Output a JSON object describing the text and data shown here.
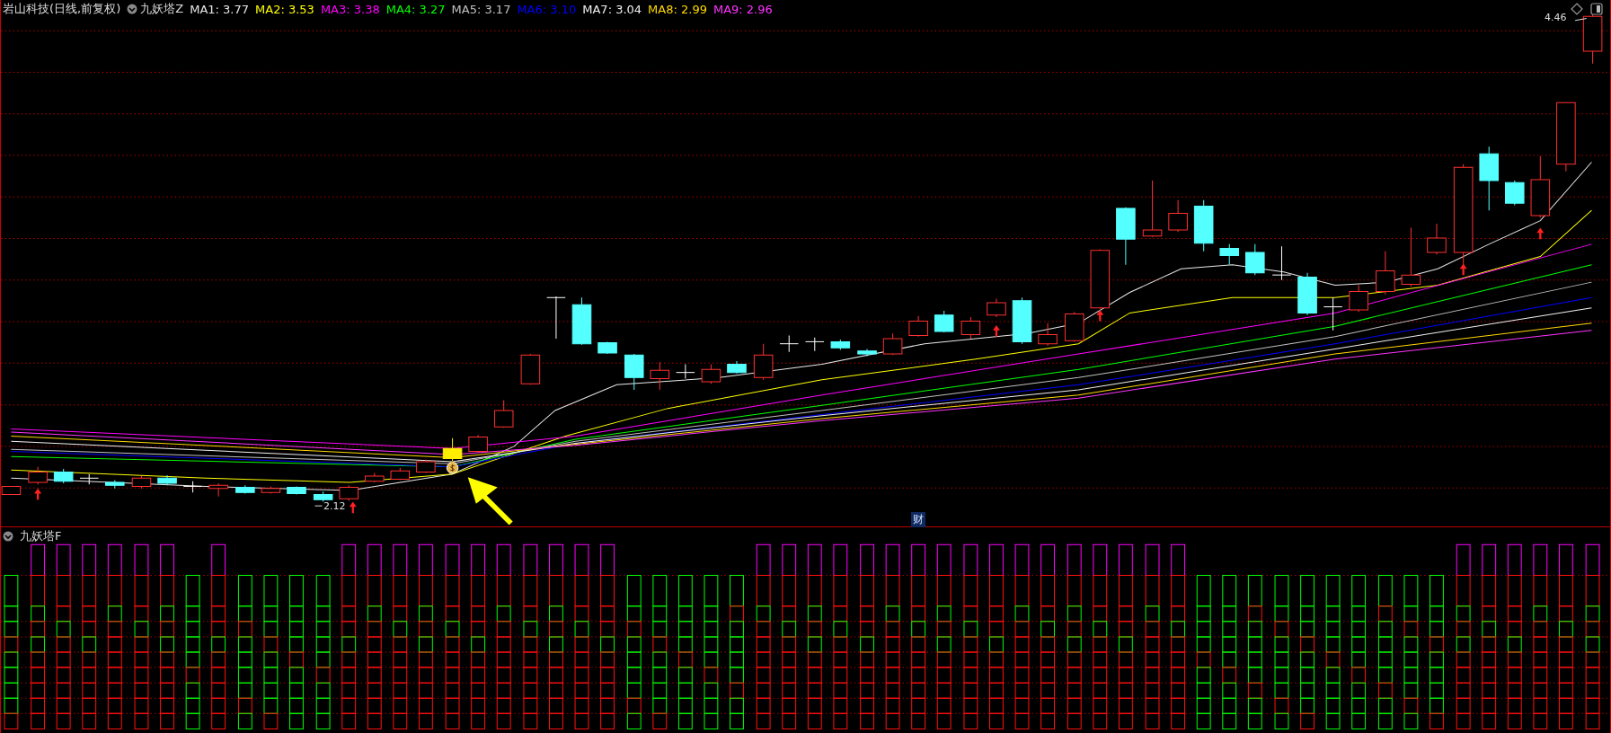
{
  "chart_header": {
    "title": "岩山科技(日线,前复权)",
    "indicator": "九妖塔Z",
    "moving_averages": [
      {
        "label": "MA1: 3.77",
        "color": "#e8e8e8"
      },
      {
        "label": "MA2: 3.53",
        "color": "#ffff00"
      },
      {
        "label": "MA3: 3.38",
        "color": "#ff00ff"
      },
      {
        "label": "MA4: 3.27",
        "color": "#00ff00"
      },
      {
        "label": "MA5: 3.17",
        "color": "#c0c0c0"
      },
      {
        "label": "MA6: 3.10",
        "color": "#0000ff"
      },
      {
        "label": "MA7: 3.04",
        "color": "#f0f0f0"
      },
      {
        "label": "MA8: 2.99",
        "color": "#ffd700"
      },
      {
        "label": "MA9: 2.96",
        "color": "#ff33ff"
      }
    ]
  },
  "price_labels": [
    {
      "kind": "high",
      "text": "4.46"
    },
    {
      "kind": "low",
      "text": "2.12"
    }
  ],
  "marker_badge": "财",
  "lower_pane": {
    "indicator": "九妖塔F"
  }
}
